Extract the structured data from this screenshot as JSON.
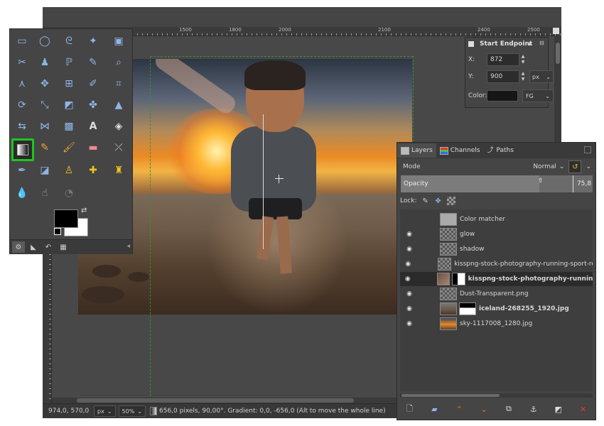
{
  "ruler": {
    "ticks": [
      "1500",
      "1800",
      "2000",
      "2100",
      "2400",
      "2500"
    ]
  },
  "statusbar": {
    "coords": "974,0, 570,0",
    "unit": "px",
    "zoom": "50%",
    "message": "656,0 pixels, 90,00°. Gradient: 0,0, -656,0 (Alt to move the whole line)"
  },
  "tool_options": {
    "title": "Start Endpoint",
    "x_label": "X:",
    "x_value": "872",
    "y_label": "Y:",
    "y_value": "900",
    "unit": "px",
    "color_label": "Color:",
    "color_mode": "FG"
  },
  "layers_panel": {
    "tabs": [
      "Layers",
      "Channels",
      "Paths"
    ],
    "mode_label": "Mode",
    "mode_value": "Normal",
    "opacity_label": "Opacity",
    "opacity_value": "75,8",
    "lock_label": "Lock:",
    "layers": [
      {
        "name": "Color matcher",
        "visible": false
      },
      {
        "name": "glow",
        "visible": true
      },
      {
        "name": "shadow",
        "visible": true
      },
      {
        "name": "kisspng-stock-photography-running-sport-royalty-free",
        "visible": true
      },
      {
        "name": "kisspng-stock-photography-running-sport-roy",
        "visible": true
      },
      {
        "name": "Dust-Transparent.png",
        "visible": true
      },
      {
        "name": "iceland-268255_1920.jpg",
        "visible": true
      },
      {
        "name": "sky-1117008_1280.jpg",
        "visible": true
      }
    ]
  },
  "toolbox": {
    "active_tool": "gradient-tool",
    "fg_color": "#000000",
    "bg_color": "#ffffff"
  },
  "colors": {
    "accent": "#1ec51e",
    "guide": "#3a8c3a",
    "panel": "#454545"
  }
}
